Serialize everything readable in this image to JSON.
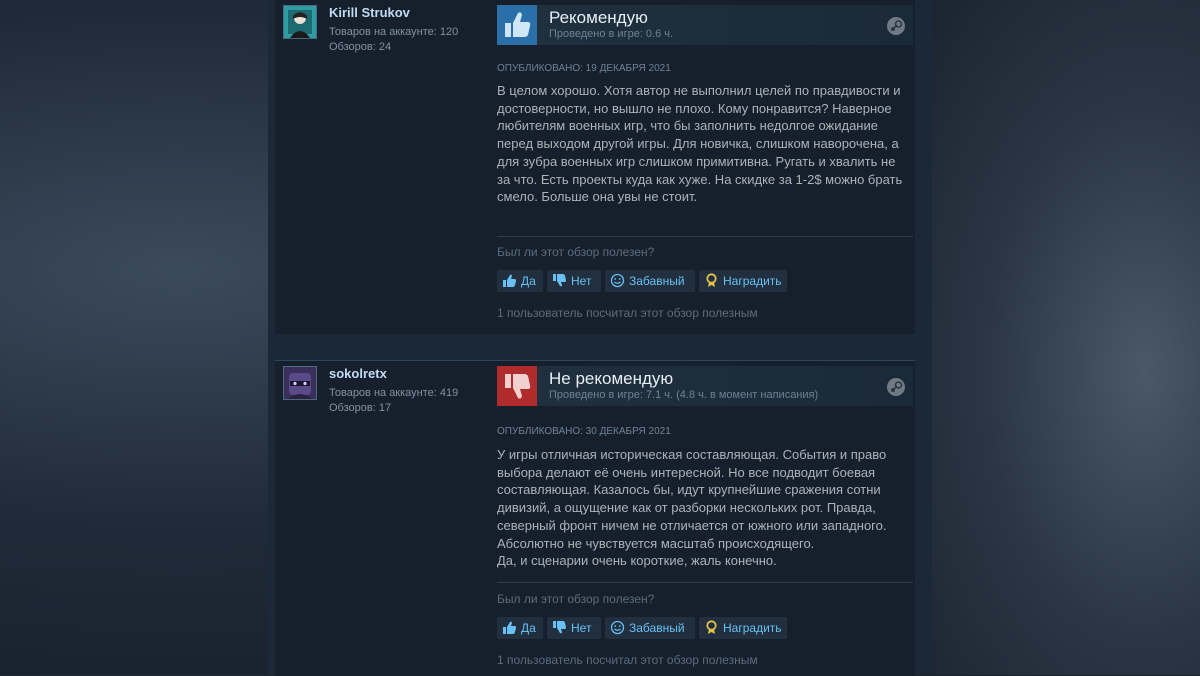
{
  "reviews": [
    {
      "author": {
        "name": "Kirill Strukov",
        "products": "Товаров на аккаунте: 120",
        "reviews": "Обзоров: 24"
      },
      "verdict": "Рекомендую",
      "hours": "Проведено в игре: 0.6 ч.",
      "posted": "ОПУБЛИКОВАНО: 19 ДЕКАБРЯ 2021",
      "text": [
        "В целом хорошо. Хотя автор не выполнил целей по правдивости и достоверности, но вышло не плохо. Кому понравится? Наверное любителям военных игр, что бы заполнить недолгое ожидание перед выходом другой игры. Для новичка, слишком наворочена, а для зубра военных игр слишком примитивна. Ругать и хвалить не за что. Есть проекты куда как хуже. На скидке за 1-2$ можно брать смело. Больше она увы не стоит."
      ],
      "helpful_question": "Был ли этот обзор полезен?",
      "buttons": {
        "yes": "Да",
        "no": "Нет",
        "funny": "Забавный",
        "award": "Наградить"
      },
      "helpful_count": "1 пользователь посчитал этот обзор полезным"
    },
    {
      "author": {
        "name": "sokolretx",
        "products": "Товаров на аккаунте: 419",
        "reviews": "Обзоров: 17"
      },
      "verdict": "Не рекомендую",
      "hours": "Проведено в игре: 7.1 ч. (4.8 ч. в момент написания)",
      "posted": "ОПУБЛИКОВАНО: 30 ДЕКАБРЯ 2021",
      "text": [
        "У игры отличная историческая составляющая. События и право выбора делают её очень интересной. Но все подводит боевая составляющая. Казалось бы, идут крупнейшие сражения сотни дивизий, а ощущение как от разборки нескольких рот. Правда, северный фронт ничем не отличается от южного или западного. Абсолютно не чувствуется масштаб происходящего.",
        "Да, и сценарии очень короткие, жаль конечно."
      ],
      "helpful_question": "Был ли этот обзор полезен?",
      "buttons": {
        "yes": "Да",
        "no": "Нет",
        "funny": "Забавный",
        "award": "Наградить"
      },
      "helpful_count": "1 пользователь посчитал этот обзор полезным"
    }
  ]
}
